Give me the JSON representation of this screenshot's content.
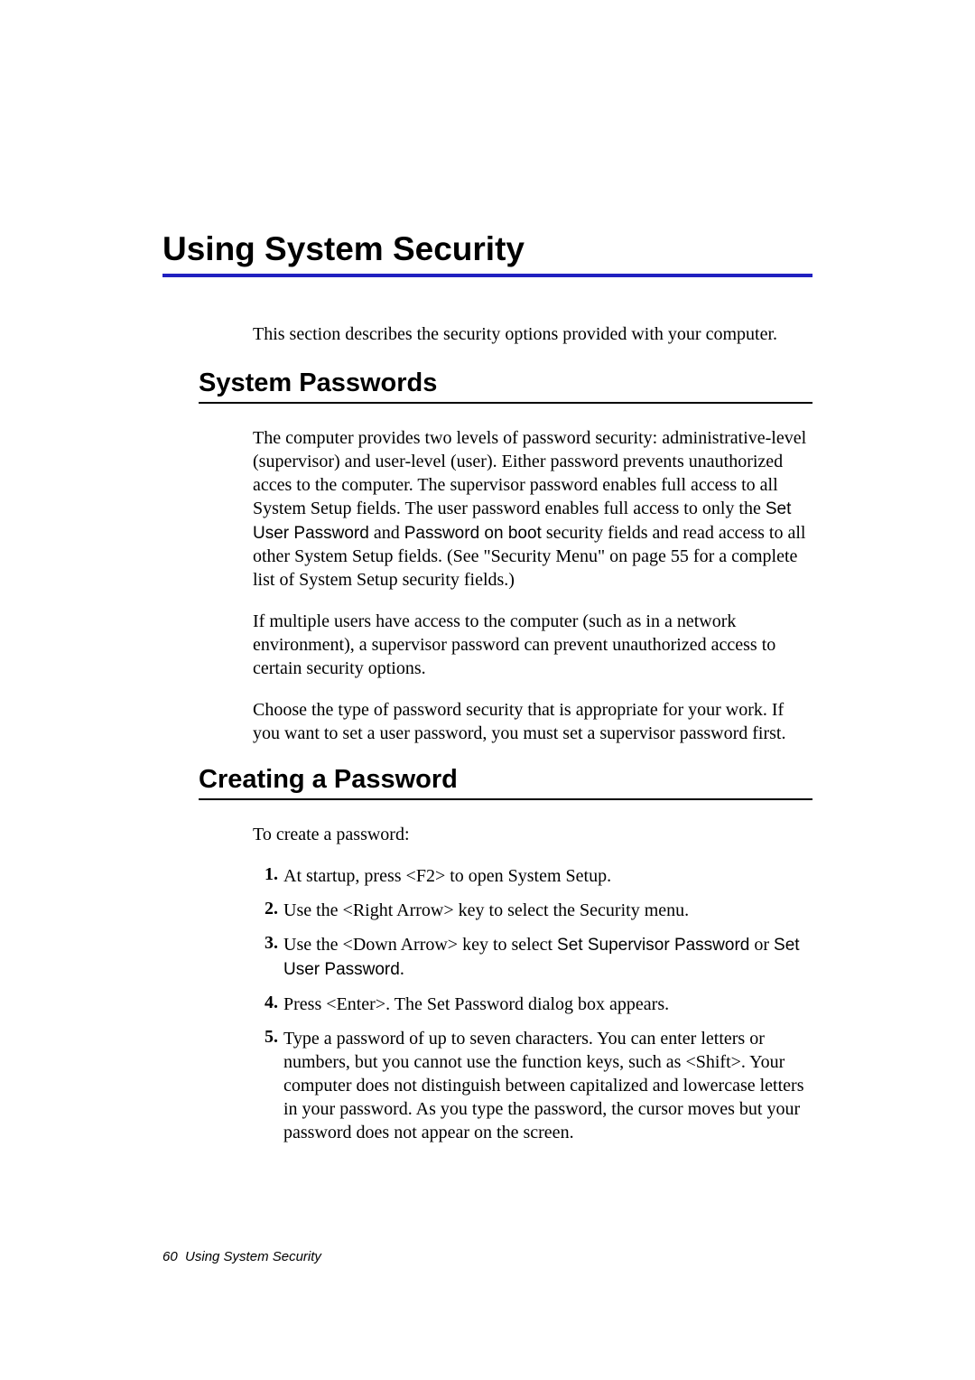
{
  "chapter_title": "Using System Security",
  "intro": "This section describes the security options provided with your computer.",
  "section1": {
    "title": "System Passwords",
    "p1_a": "The computer provides two levels of password security: administrative-level (supervisor) and user-level (user). Either password prevents unauthorized acces to the computer. The supervisor password enables full access to all System Setup fields. The user password enables full access to only the ",
    "p1_ui1": "Set User Password",
    "p1_b": " and ",
    "p1_ui2": "Password on boot",
    "p1_c": " security fields and read access to all other System Setup fields. (See \"Security Menu\" on page 55 for a complete list of System Setup security fields.)",
    "p2": "If multiple users have access to the computer (such as in a network environment), a supervisor password can prevent unauthorized access to certain security options.",
    "p3": "Choose the type of password security that is appropriate for your work. If you want to set a user password, you must set a supervisor password first."
  },
  "section2": {
    "title": "Creating a Password",
    "intro": "To create a password:",
    "items": [
      {
        "n": "1.",
        "text_a": "At startup, press <F2> to open System Setup."
      },
      {
        "n": "2.",
        "text_a": "Use the <Right Arrow> key to select the Security menu."
      },
      {
        "n": "3.",
        "text_a": "Use the <Down Arrow> key to select ",
        "ui1": "Set Supervisor Password",
        "text_b": " or ",
        "ui2": "Set User Password",
        "text_c": "."
      },
      {
        "n": "4.",
        "text_a": "Press <Enter>. The Set Password dialog box appears."
      },
      {
        "n": "5.",
        "text_a": "Type a password of up to seven characters. You can enter letters or numbers, but you cannot use the function keys, such as <Shift>. Your computer does not distinguish between capitalized and lowercase letters in your password. As you type the password, the cursor moves but your password does not appear on the screen."
      }
    ]
  },
  "footer": {
    "page_num": "60",
    "label": "Using System Security"
  }
}
